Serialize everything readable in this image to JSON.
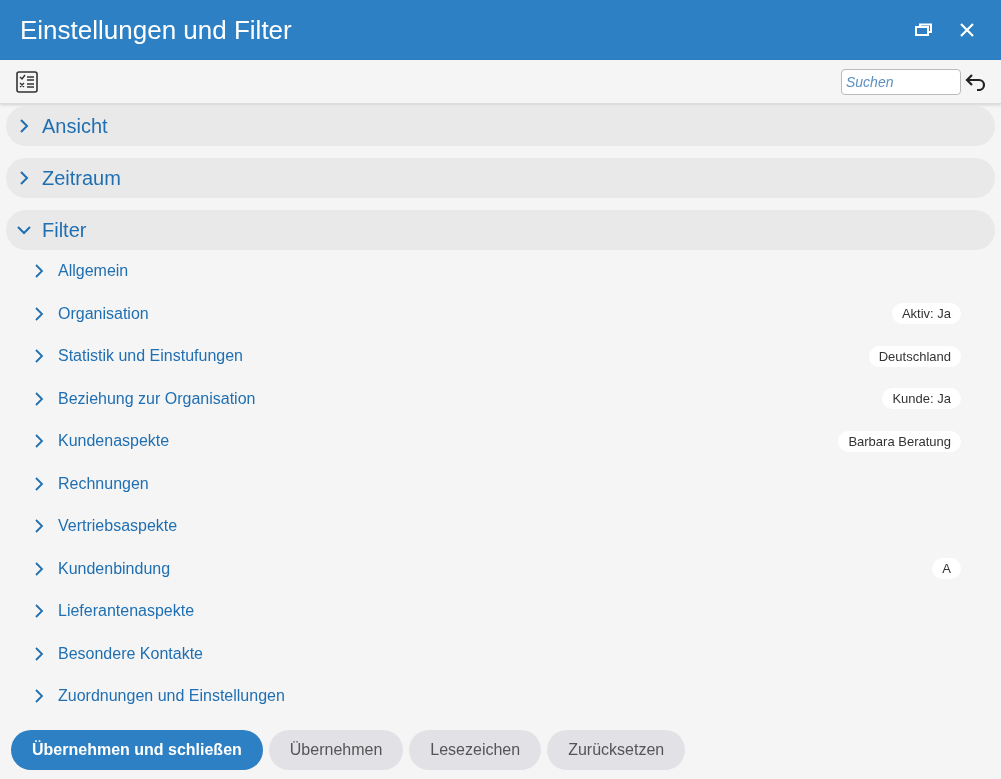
{
  "window": {
    "title": "Einstellungen und Filter"
  },
  "search": {
    "placeholder": "Suchen"
  },
  "sections": [
    {
      "label": "Ansicht",
      "expanded": false
    },
    {
      "label": "Zeitraum",
      "expanded": false
    },
    {
      "label": "Filter",
      "expanded": true,
      "items": [
        {
          "label": "Allgemein"
        },
        {
          "label": "Organisation",
          "badge": "Aktiv: Ja"
        },
        {
          "label": "Statistik und Einstufungen",
          "badge": "Deutschland"
        },
        {
          "label": "Beziehung zur Organisation",
          "badge": "Kunde: Ja"
        },
        {
          "label": "Kundenaspekte",
          "badge": "Barbara Beratung"
        },
        {
          "label": "Rechnungen"
        },
        {
          "label": "Vertriebsaspekte"
        },
        {
          "label": "Kundenbindung",
          "badge": "A"
        },
        {
          "label": "Lieferantenaspekte"
        },
        {
          "label": "Besondere Kontakte"
        },
        {
          "label": "Zuordnungen und Einstellungen"
        }
      ]
    }
  ],
  "buttons": [
    {
      "label": "Übernehmen und schließen",
      "kind": "primary"
    },
    {
      "label": "Übernehmen",
      "kind": "secondary"
    },
    {
      "label": "Lesezeichen",
      "kind": "secondary"
    },
    {
      "label": "Zurücksetzen",
      "kind": "secondary"
    }
  ]
}
